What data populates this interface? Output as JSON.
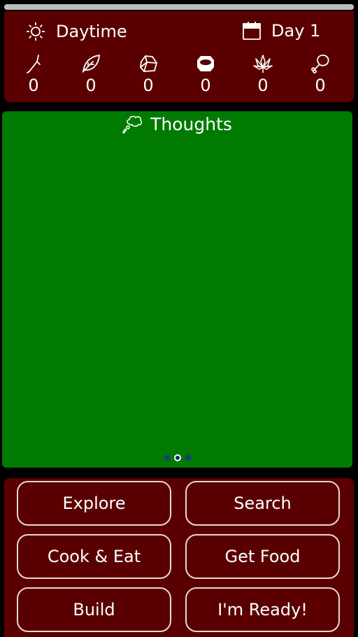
{
  "progress": {
    "fraction": 1.0
  },
  "status": {
    "time_of_day": "Daytime",
    "time_icon": "sun-icon",
    "day_label": "Day 1",
    "day_icon": "calendar-icon"
  },
  "resources": [
    {
      "icon": "stick-icon",
      "count": "0"
    },
    {
      "icon": "leaf-icon",
      "count": "0"
    },
    {
      "icon": "stone-icon",
      "count": "0"
    },
    {
      "icon": "bowl-icon",
      "count": "0"
    },
    {
      "icon": "plant-icon",
      "count": "0"
    },
    {
      "icon": "meat-icon",
      "count": "0"
    }
  ],
  "thoughts": {
    "title": "Thoughts",
    "icon": "thought-bubble-icon",
    "pages": 3,
    "active_page": 1
  },
  "actions": {
    "explore": "Explore",
    "search": "Search",
    "cook_eat": "Cook & Eat",
    "get_food": "Get Food",
    "build": "Build",
    "ready": "I'm Ready!"
  },
  "colors": {
    "status_bg": "#5a0000",
    "thoughts_bg": "#007a00",
    "button_border": "#e8d9cf",
    "page_dot": "#1a3a8a"
  }
}
